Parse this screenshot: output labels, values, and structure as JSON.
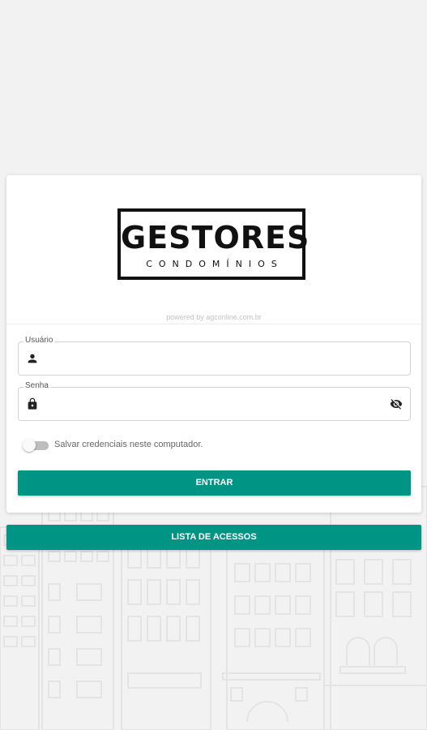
{
  "logo": {
    "title": "GESTORES",
    "subtitle": "CONDOMÍNIOS"
  },
  "powered_by": "powered by agconline.com.br",
  "form": {
    "username": {
      "label": "Usuário",
      "value": "",
      "icon": "person-icon"
    },
    "password": {
      "label": "Senha",
      "value": "",
      "icon": "lock-icon",
      "trailing_icon": "visibility-off-icon"
    },
    "remember": {
      "label": "Salvar credenciais neste computador.",
      "checked": false
    },
    "submit_label": "ENTRAR"
  },
  "access_list_label": "LISTA DE ACESSOS",
  "colors": {
    "primary": "#009485",
    "background": "#f2f2f2",
    "card": "#ffffff"
  }
}
